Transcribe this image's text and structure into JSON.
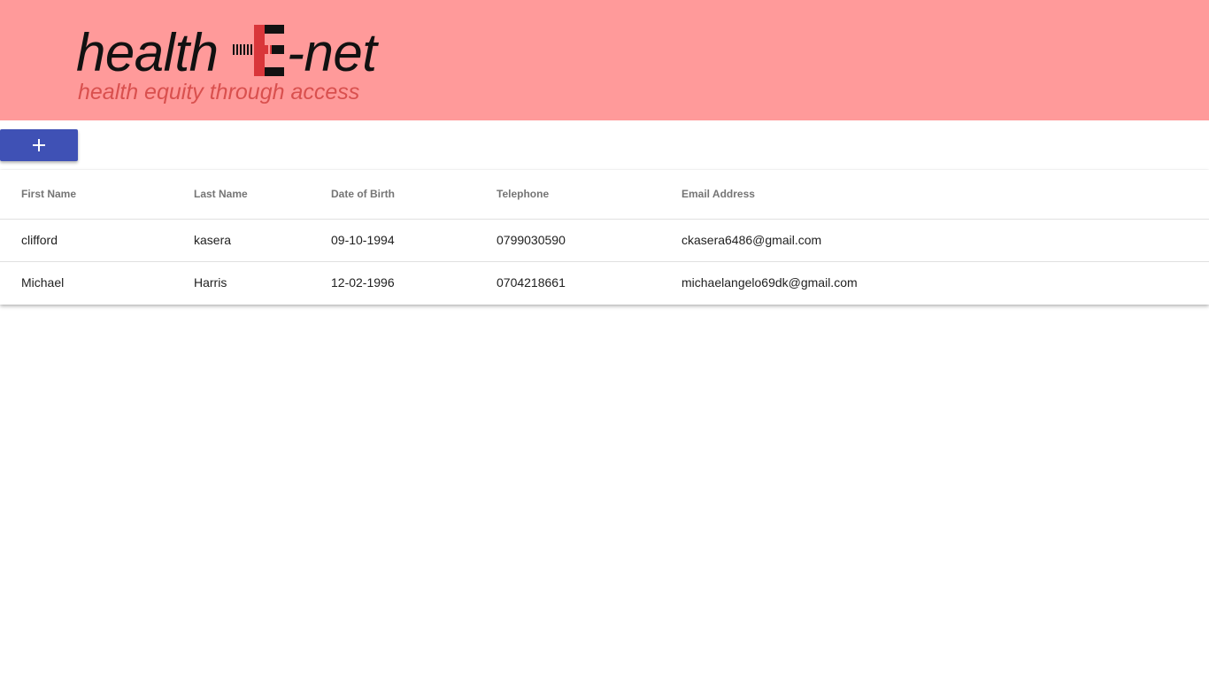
{
  "header": {
    "logo": {
      "word_left": "health",
      "word_right": "-net",
      "mark_letter": "E",
      "tagline": "health equity through access"
    },
    "background_color": "#ff9a9a"
  },
  "toolbar": {
    "add_button": {
      "icon": "plus-icon",
      "color": "#3f51b5"
    }
  },
  "table": {
    "columns": [
      "First Name",
      "Last Name",
      "Date of Birth",
      "Telephone",
      "Email Address"
    ],
    "rows": [
      [
        "clifford",
        "kasera",
        "09-10-1994",
        "0799030590",
        "ckasera6486@gmail.com"
      ],
      [
        "Michael",
        "Harris",
        "12-02-1996",
        "0704218661",
        "michaelangelo69dk@gmail.com"
      ]
    ]
  }
}
